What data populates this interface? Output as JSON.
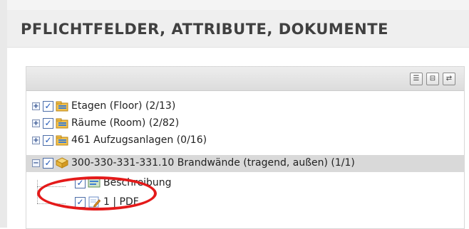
{
  "panel": {
    "title": "PFLICHTFELDER, ATTRIBUTE, DOKUMENTE"
  },
  "toolbar": {
    "buttons": [
      {
        "icon": "list-view-icon",
        "glyph": "☰"
      },
      {
        "icon": "tree-view-icon",
        "glyph": "⊟"
      },
      {
        "icon": "refresh-icon",
        "glyph": "⇄"
      }
    ]
  },
  "tree": {
    "items": [
      {
        "label": "Etagen (Floor) (2/13)",
        "expander": "+",
        "checked": true,
        "icon": "folder-layers-icon"
      },
      {
        "label": "Räume (Room) (2/82)",
        "expander": "+",
        "checked": true,
        "icon": "folder-layers-icon"
      },
      {
        "label": "461 Aufzugsanlagen (0/16)",
        "expander": "+",
        "checked": true,
        "icon": "folder-layers-icon"
      },
      {
        "label": "300-330-331-331.10 Brandwände (tragend, außen) (1/1)",
        "expander": "−",
        "checked": true,
        "icon": "cube-icon",
        "selected": true
      },
      {
        "label": "Beschreibung",
        "checked": true,
        "icon": "description-icon"
      },
      {
        "label": "1 | PDF",
        "checked": true,
        "icon": "document-edit-icon"
      }
    ]
  },
  "colors": {
    "annotation": "#e41a1a",
    "selected_row": "#d9d9d9",
    "title_text": "#404040"
  }
}
